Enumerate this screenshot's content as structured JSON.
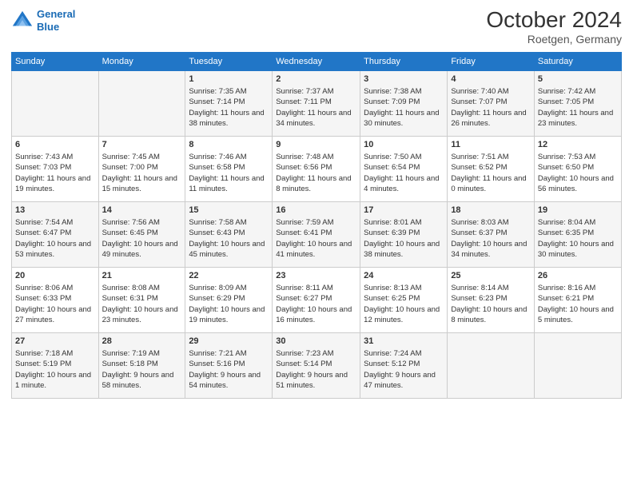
{
  "header": {
    "logo_line1": "General",
    "logo_line2": "Blue",
    "month_title": "October 2024",
    "subtitle": "Roetgen, Germany"
  },
  "weekdays": [
    "Sunday",
    "Monday",
    "Tuesday",
    "Wednesday",
    "Thursday",
    "Friday",
    "Saturday"
  ],
  "weeks": [
    [
      {
        "day": "",
        "sunrise": "",
        "sunset": "",
        "daylight": ""
      },
      {
        "day": "",
        "sunrise": "",
        "sunset": "",
        "daylight": ""
      },
      {
        "day": "1",
        "sunrise": "Sunrise: 7:35 AM",
        "sunset": "Sunset: 7:14 PM",
        "daylight": "Daylight: 11 hours and 38 minutes."
      },
      {
        "day": "2",
        "sunrise": "Sunrise: 7:37 AM",
        "sunset": "Sunset: 7:11 PM",
        "daylight": "Daylight: 11 hours and 34 minutes."
      },
      {
        "day": "3",
        "sunrise": "Sunrise: 7:38 AM",
        "sunset": "Sunset: 7:09 PM",
        "daylight": "Daylight: 11 hours and 30 minutes."
      },
      {
        "day": "4",
        "sunrise": "Sunrise: 7:40 AM",
        "sunset": "Sunset: 7:07 PM",
        "daylight": "Daylight: 11 hours and 26 minutes."
      },
      {
        "day": "5",
        "sunrise": "Sunrise: 7:42 AM",
        "sunset": "Sunset: 7:05 PM",
        "daylight": "Daylight: 11 hours and 23 minutes."
      }
    ],
    [
      {
        "day": "6",
        "sunrise": "Sunrise: 7:43 AM",
        "sunset": "Sunset: 7:03 PM",
        "daylight": "Daylight: 11 hours and 19 minutes."
      },
      {
        "day": "7",
        "sunrise": "Sunrise: 7:45 AM",
        "sunset": "Sunset: 7:00 PM",
        "daylight": "Daylight: 11 hours and 15 minutes."
      },
      {
        "day": "8",
        "sunrise": "Sunrise: 7:46 AM",
        "sunset": "Sunset: 6:58 PM",
        "daylight": "Daylight: 11 hours and 11 minutes."
      },
      {
        "day": "9",
        "sunrise": "Sunrise: 7:48 AM",
        "sunset": "Sunset: 6:56 PM",
        "daylight": "Daylight: 11 hours and 8 minutes."
      },
      {
        "day": "10",
        "sunrise": "Sunrise: 7:50 AM",
        "sunset": "Sunset: 6:54 PM",
        "daylight": "Daylight: 11 hours and 4 minutes."
      },
      {
        "day": "11",
        "sunrise": "Sunrise: 7:51 AM",
        "sunset": "Sunset: 6:52 PM",
        "daylight": "Daylight: 11 hours and 0 minutes."
      },
      {
        "day": "12",
        "sunrise": "Sunrise: 7:53 AM",
        "sunset": "Sunset: 6:50 PM",
        "daylight": "Daylight: 10 hours and 56 minutes."
      }
    ],
    [
      {
        "day": "13",
        "sunrise": "Sunrise: 7:54 AM",
        "sunset": "Sunset: 6:47 PM",
        "daylight": "Daylight: 10 hours and 53 minutes."
      },
      {
        "day": "14",
        "sunrise": "Sunrise: 7:56 AM",
        "sunset": "Sunset: 6:45 PM",
        "daylight": "Daylight: 10 hours and 49 minutes."
      },
      {
        "day": "15",
        "sunrise": "Sunrise: 7:58 AM",
        "sunset": "Sunset: 6:43 PM",
        "daylight": "Daylight: 10 hours and 45 minutes."
      },
      {
        "day": "16",
        "sunrise": "Sunrise: 7:59 AM",
        "sunset": "Sunset: 6:41 PM",
        "daylight": "Daylight: 10 hours and 41 minutes."
      },
      {
        "day": "17",
        "sunrise": "Sunrise: 8:01 AM",
        "sunset": "Sunset: 6:39 PM",
        "daylight": "Daylight: 10 hours and 38 minutes."
      },
      {
        "day": "18",
        "sunrise": "Sunrise: 8:03 AM",
        "sunset": "Sunset: 6:37 PM",
        "daylight": "Daylight: 10 hours and 34 minutes."
      },
      {
        "day": "19",
        "sunrise": "Sunrise: 8:04 AM",
        "sunset": "Sunset: 6:35 PM",
        "daylight": "Daylight: 10 hours and 30 minutes."
      }
    ],
    [
      {
        "day": "20",
        "sunrise": "Sunrise: 8:06 AM",
        "sunset": "Sunset: 6:33 PM",
        "daylight": "Daylight: 10 hours and 27 minutes."
      },
      {
        "day": "21",
        "sunrise": "Sunrise: 8:08 AM",
        "sunset": "Sunset: 6:31 PM",
        "daylight": "Daylight: 10 hours and 23 minutes."
      },
      {
        "day": "22",
        "sunrise": "Sunrise: 8:09 AM",
        "sunset": "Sunset: 6:29 PM",
        "daylight": "Daylight: 10 hours and 19 minutes."
      },
      {
        "day": "23",
        "sunrise": "Sunrise: 8:11 AM",
        "sunset": "Sunset: 6:27 PM",
        "daylight": "Daylight: 10 hours and 16 minutes."
      },
      {
        "day": "24",
        "sunrise": "Sunrise: 8:13 AM",
        "sunset": "Sunset: 6:25 PM",
        "daylight": "Daylight: 10 hours and 12 minutes."
      },
      {
        "day": "25",
        "sunrise": "Sunrise: 8:14 AM",
        "sunset": "Sunset: 6:23 PM",
        "daylight": "Daylight: 10 hours and 8 minutes."
      },
      {
        "day": "26",
        "sunrise": "Sunrise: 8:16 AM",
        "sunset": "Sunset: 6:21 PM",
        "daylight": "Daylight: 10 hours and 5 minutes."
      }
    ],
    [
      {
        "day": "27",
        "sunrise": "Sunrise: 7:18 AM",
        "sunset": "Sunset: 5:19 PM",
        "daylight": "Daylight: 10 hours and 1 minute."
      },
      {
        "day": "28",
        "sunrise": "Sunrise: 7:19 AM",
        "sunset": "Sunset: 5:18 PM",
        "daylight": "Daylight: 9 hours and 58 minutes."
      },
      {
        "day": "29",
        "sunrise": "Sunrise: 7:21 AM",
        "sunset": "Sunset: 5:16 PM",
        "daylight": "Daylight: 9 hours and 54 minutes."
      },
      {
        "day": "30",
        "sunrise": "Sunrise: 7:23 AM",
        "sunset": "Sunset: 5:14 PM",
        "daylight": "Daylight: 9 hours and 51 minutes."
      },
      {
        "day": "31",
        "sunrise": "Sunrise: 7:24 AM",
        "sunset": "Sunset: 5:12 PM",
        "daylight": "Daylight: 9 hours and 47 minutes."
      },
      {
        "day": "",
        "sunrise": "",
        "sunset": "",
        "daylight": ""
      },
      {
        "day": "",
        "sunrise": "",
        "sunset": "",
        "daylight": ""
      }
    ]
  ]
}
